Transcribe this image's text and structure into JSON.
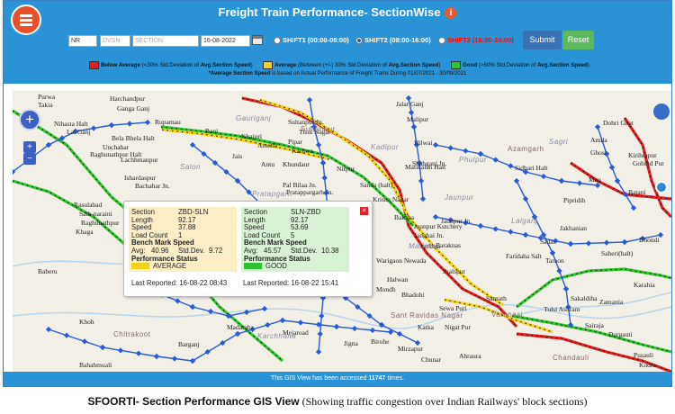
{
  "header": {
    "title": "Freight Train Performance- SectionWise",
    "info_icon": "info-icon"
  },
  "filters": {
    "zone": "NR",
    "division_placeholder": "DVSN",
    "section_placeholder": "SECTION",
    "date": "16-08-2022",
    "shifts": [
      {
        "label": "SHIFT1 (00:00-08:00)",
        "selected": false
      },
      {
        "label": "SHIFT2 (08:00-16:00)",
        "selected": true
      },
      {
        "label": "SHIFT3 (16:00-24:00)",
        "selected": false
      }
    ],
    "submit_label": "Submit",
    "reset_label": "Reset"
  },
  "legend": {
    "items": [
      {
        "name": "Below Average",
        "desc_pre": " (<30% Std.Deviation of ",
        "desc_bold": "Avg.Section Speed",
        "desc_post": ")",
        "color": "#e01e1e"
      },
      {
        "name": "Average",
        "desc_pre": " (Between (+/-) 30% Std.Deviation of ",
        "desc_bold": "Avg.Section Speed",
        "desc_post": ")",
        "color": "#f0d21a"
      },
      {
        "name": "Good",
        "desc_pre": " (>50% Std.Deviation of ",
        "desc_bold": "Avg.Section Speed",
        "desc_post": ")",
        "color": "#2cc32c"
      }
    ],
    "note_bold": "*Average Section Speed",
    "note_rest": " is based on Actual Performance of Freight Trains During 01/07/2021 - 30/09/2021"
  },
  "popup": {
    "sections": [
      {
        "section_label": "Section",
        "section": "ZBD-SLN",
        "length_label": "Length",
        "length": "92.17",
        "speed_label": "Speed",
        "speed": "37.88",
        "load_label": "Load Count",
        "load": "1",
        "bench_label": "Bench Mark Speed",
        "avg_label": "Avg:",
        "avg": "40.96",
        "std_label": "Std.Dev.",
        "std": "9.72",
        "perf_label": "Performance Status",
        "status": "AVERAGE",
        "status_color": "#f0d21a",
        "last_label": "Last Reported:",
        "last": "16-08-22 08:43"
      },
      {
        "section_label": "Section",
        "section": "SLN-ZBD",
        "length_label": "Length",
        "length": "92.17",
        "speed_label": "Speed",
        "speed": "53.69",
        "load_label": "Load Count",
        "load": "5",
        "bench_label": "Bench Mark Speed",
        "avg_label": "Avg:",
        "avg": "45.57",
        "std_label": "Std.Dev.",
        "std": "10.38",
        "perf_label": "Performance Status",
        "status": "GOOD",
        "status_color": "#2cc32c",
        "last_label": "Last Reported:",
        "last": "16-08-22 15:41"
      }
    ]
  },
  "map": {
    "places": [
      "Purwa",
      "Takia",
      "Harchandpur",
      "Ganga Ganj",
      "Nihasta Halt",
      "Lal Ganj",
      "Rupamau",
      "Bela Bhela Halt",
      "Unchahar",
      "Raghunathpur Halt",
      "Lachhmanpur",
      "Ishardaspur",
      "Bachahar Jn.",
      "Rasulabad",
      "Sath-naraini",
      "Raghunathpur",
      "Khaga",
      "Baberu",
      "Khoh",
      "Bahahmuali",
      "Bani",
      "Khajuri",
      "Amethi",
      "Jais",
      "Antu",
      "Khundaur",
      "Sultanpur Jn.",
      "Tisui Nagar",
      "Pipar",
      "Karhwa",
      "Nirpur",
      "Pal Bilaa Jn.",
      "Pratappargarh Jn.",
      "Sanda (halt)",
      "Krisna Nagar",
      "Matikalan Halt",
      "Baksha",
      "Jaunpur Kutchery",
      "Janghai Jn.",
      "Jaunpur Jn.",
      "Sarkoni",
      "Shahganj Jn.",
      "Malipur",
      "Hilwai",
      "Jalar Ganj",
      "Sidhari Halt",
      "Mau",
      "Ghosi",
      "Amila",
      "Dohri Ghat",
      "Kirihrapur",
      "Gobind Pur",
      "Batani",
      "Pipridih",
      "Jakhanian",
      "Sadat",
      "Dhondi",
      "Taraon",
      "Faridaha Salt",
      "Saheri(halt)",
      "Sakaldiha",
      "Zamania",
      "Sairaja",
      "Durgauti",
      "Tulsi Ashram",
      "Karahia",
      "Kudra",
      "Pusauli",
      "Sarnath",
      "Sewa Puri",
      "Bhadohi",
      "Mondh",
      "Halwan",
      "Warigaon Newada",
      "Baraknas",
      "Jhalspur",
      "Katka",
      "Nigat Pur",
      "Madaraha",
      "Barganj",
      "Mejaroad",
      "Jigna",
      "Birohe",
      "Mirzapur",
      "Chunar",
      "Ahraura",
      "Sultanpur",
      "Bhadohi Jn.",
      "Bargarh",
      "Ahraura Jn."
    ],
    "regions": [
      "Gauriganj",
      "Salon",
      "Pratapgarh",
      "Kadipur",
      "Jaunpur",
      "Phulpur",
      "Sagri",
      "Lalganj",
      "Chandauli",
      "Karchhana",
      "Mariahu",
      "Chitrakoot",
      "Azamgarh",
      "Sant Ravidas Nagar",
      "Varanasi",
      "Sultanpur"
    ]
  },
  "footer": {
    "pre": "This GIS View has been accessed ",
    "count": "11747",
    "post": " times."
  },
  "caption": {
    "bold": "SFOORTI- Section Performance GIS View",
    "rest": " (Showing traffic congestion over Indian Railways' block sections)"
  },
  "colors": {
    "header_bg": "#2a93d6",
    "track_red": "#e01e1e",
    "track_yellow": "#f0d21a",
    "track_green": "#2cc32c",
    "station_blue": "#2a5ad8"
  }
}
